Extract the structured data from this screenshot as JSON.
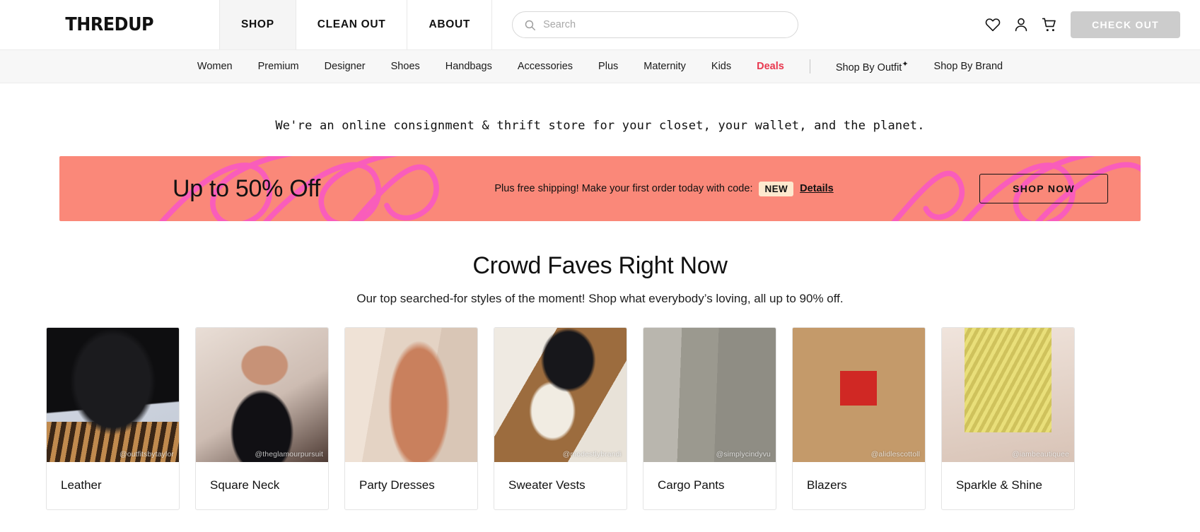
{
  "header": {
    "logo_main": "THRED",
    "logo_sup": "UP",
    "tabs": [
      {
        "label": "SHOP",
        "active": true
      },
      {
        "label": "CLEAN OUT",
        "active": false
      },
      {
        "label": "ABOUT",
        "active": false
      }
    ],
    "search": {
      "placeholder": "Search",
      "value": "",
      "icon": "search-icon"
    },
    "icons": [
      "heart-icon",
      "user-icon",
      "cart-icon"
    ],
    "checkout_label": "CHECK OUT",
    "checkout_color": "#cccccc"
  },
  "subnav": {
    "items": [
      {
        "label": "Women",
        "deal": false
      },
      {
        "label": "Premium",
        "deal": false
      },
      {
        "label": "Designer",
        "deal": false
      },
      {
        "label": "Shoes",
        "deal": false
      },
      {
        "label": "Handbags",
        "deal": false
      },
      {
        "label": "Accessories",
        "deal": false
      },
      {
        "label": "Plus",
        "deal": false
      },
      {
        "label": "Maternity",
        "deal": false
      },
      {
        "label": "Kids",
        "deal": false
      },
      {
        "label": "Deals",
        "deal": true
      }
    ],
    "right_items": [
      {
        "label": "Shop By Outfit",
        "sparkle": "✦"
      },
      {
        "label": "Shop By Brand",
        "sparkle": ""
      }
    ],
    "deal_color": "#e8384f"
  },
  "tagline": "We're an online consignment & thrift store for your closet, your wallet, and the planet.",
  "promo": {
    "headline": "Up to 50% Off",
    "message": "Plus free shipping! Make your first order today with code:",
    "code": "NEW",
    "details_label": "Details",
    "cta_label": "SHOP NOW",
    "background_color": "#fa8879",
    "squiggle_color": "#f95dbb",
    "code_badge_color": "#fde9cf"
  },
  "section": {
    "title": "Crowd Faves Right Now",
    "subtitle": "Our top searched-for styles of the moment! Shop what everybody’s loving, all up to 90% off."
  },
  "cards": [
    {
      "label": "Leather",
      "handle": "@outfitsbytaylor",
      "art": "ph-leather"
    },
    {
      "label": "Square Neck",
      "handle": "@theglamourpursuit",
      "art": "ph-squareneck"
    },
    {
      "label": "Party Dresses",
      "handle": "",
      "art": "ph-party"
    },
    {
      "label": "Sweater Vests",
      "handle": "@modestlybrandi",
      "art": "ph-sweater"
    },
    {
      "label": "Cargo Pants",
      "handle": "@simplycindyvu",
      "art": "ph-cargo"
    },
    {
      "label": "Blazers",
      "handle": "@alidlescottoll",
      "art": "ph-blazer"
    },
    {
      "label": "Sparkle & Shine",
      "handle": "@iambeautiquee",
      "art": "ph-sparkle"
    }
  ]
}
